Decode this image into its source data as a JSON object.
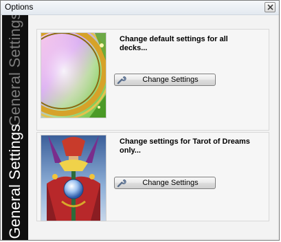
{
  "window": {
    "title": "Options",
    "close_symbol": "×"
  },
  "sidebar": {
    "tabs": [
      {
        "label": "General Settings",
        "active": false
      },
      {
        "label": "General Settings",
        "active": true
      }
    ]
  },
  "panels": [
    {
      "description": "Change default settings for all decks...",
      "button_label": "Change Settings",
      "button_icon": "wrench-icon",
      "thumbnail": "card-back-thumbnail"
    },
    {
      "description": "Change settings for Tarot of Dreams only...",
      "button_label": "Change Settings",
      "button_icon": "wrench-icon",
      "thumbnail": "tarot-card-thumbnail"
    }
  ],
  "colors": {
    "sidebar_bg": "#101010",
    "active_tab_text": "#ffffff",
    "inactive_tab_text": "#7c7c7c"
  }
}
